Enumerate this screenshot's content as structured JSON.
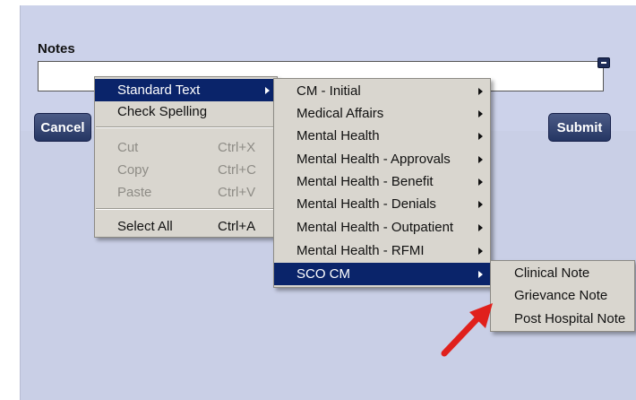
{
  "notes": {
    "label": "Notes",
    "value": ""
  },
  "buttons": {
    "cancel": "Cancel",
    "submit": "Submit"
  },
  "context_menu": {
    "items": [
      {
        "label": "Standard Text",
        "has_submenu": true,
        "highlighted": true
      },
      {
        "label": "Check Spelling"
      },
      {
        "label": "Cut",
        "shortcut": "Ctrl+X",
        "disabled": true
      },
      {
        "label": "Copy",
        "shortcut": "Ctrl+C",
        "disabled": true
      },
      {
        "label": "Paste",
        "shortcut": "Ctrl+V",
        "disabled": true
      },
      {
        "label": "Select All",
        "shortcut": "Ctrl+A"
      }
    ]
  },
  "standard_text_menu": {
    "items": [
      {
        "label": "CM - Initial"
      },
      {
        "label": "Medical Affairs"
      },
      {
        "label": "Mental Health"
      },
      {
        "label": "Mental Health - Approvals"
      },
      {
        "label": "Mental Health - Benefit"
      },
      {
        "label": "Mental Health - Denials"
      },
      {
        "label": "Mental Health - Outpatient"
      },
      {
        "label": "Mental Health - RFMI"
      },
      {
        "label": "SCO CM",
        "highlighted": true
      }
    ]
  },
  "sco_cm_menu": {
    "items": [
      {
        "label": "Clinical Note"
      },
      {
        "label": "Grievance Note"
      },
      {
        "label": "Post Hospital Note"
      }
    ]
  },
  "colors": {
    "panel": "#c9cfe6",
    "button": "#253663",
    "menu_bg": "#d9d6cf",
    "highlight": "#0a246a",
    "annotation_arrow": "#e0201c"
  }
}
